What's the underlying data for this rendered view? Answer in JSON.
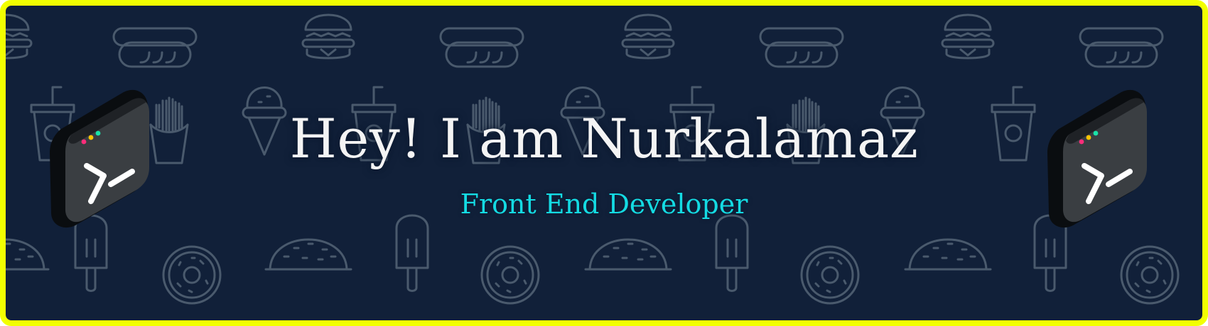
{
  "banner": {
    "title": "Hey! I am Nurkalamaz",
    "subtitle": "Front End Developer"
  },
  "colors": {
    "frame": "#f2ff00",
    "background": "#112039",
    "pattern_stroke": "#4a5a6d",
    "title": "#f4f4f4",
    "subtitle": "#14dbe3",
    "terminal_dots": [
      "#ff2d7a",
      "#ffc400",
      "#19e3a8"
    ]
  },
  "icons": {
    "background_pattern": [
      "burger-icon",
      "hotdog-icon",
      "soda-cup-icon",
      "fries-icon",
      "ice-cream-cone-icon",
      "popsicle-icon",
      "taco-icon",
      "donut-icon"
    ],
    "decorations": [
      "terminal-app-icon",
      "terminal-app-icon"
    ]
  }
}
